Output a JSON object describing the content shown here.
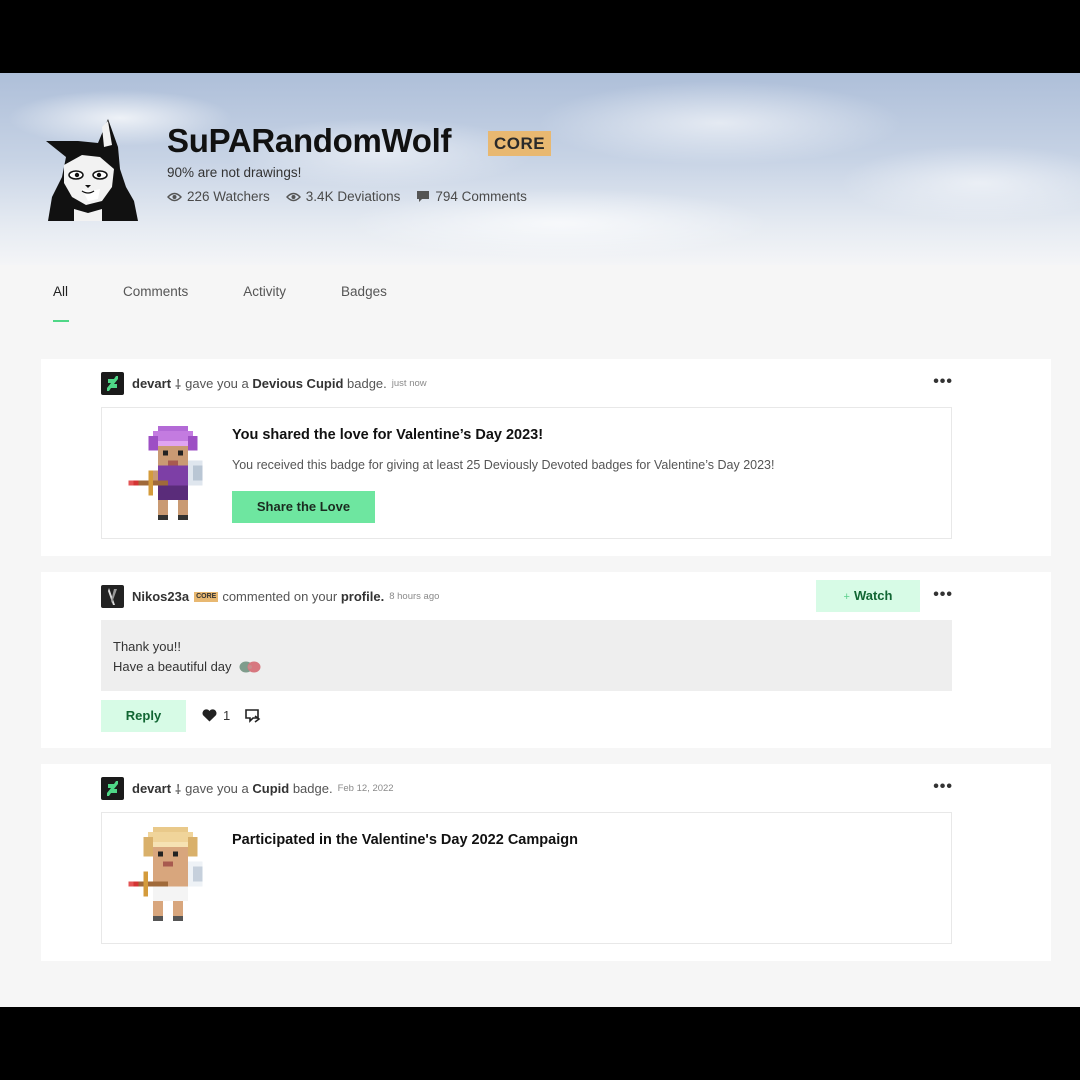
{
  "profile": {
    "username": "SuPARandomWolf",
    "membership": "CORE",
    "tagline": "90% are not drawings!",
    "stats": {
      "watchers": "226 Watchers",
      "deviations": "3.4K Deviations",
      "comments": "794 Comments"
    }
  },
  "tabs": [
    "All",
    "Comments",
    "Activity",
    "Badges"
  ],
  "feed": [
    {
      "user": "devart",
      "action": "gave you a",
      "badge_name": "Devious Cupid",
      "action_suffix": "badge.",
      "time": "just now",
      "badge_title": "You shared the love for Valentine’s Day 2023!",
      "badge_description": "You received this badge for giving at least 25 Deviously Devoted badges for Valentine’s Day 2023!",
      "button_label": "Share the Love"
    },
    {
      "user": "Nikos23a",
      "user_badge": "CORE",
      "action": "commented on your",
      "target": "profile.",
      "time": "8 hours ago",
      "watch_label": "Watch",
      "comment_lines": [
        "Thank you!!",
        "Have a beautiful day"
      ],
      "reply_label": "Reply",
      "like_count": "1"
    },
    {
      "user": "devart",
      "action": "gave you a",
      "badge_name": "Cupid",
      "action_suffix": "badge.",
      "time": "Feb 12, 2022",
      "badge_title": "Participated in the Valentine's Day 2022 Campaign"
    }
  ],
  "colors": {
    "accent_green": "#4fd787",
    "button_green": "#6ee6a0",
    "light_green": "#d7fbe6",
    "core_gold": "#e8b871"
  }
}
